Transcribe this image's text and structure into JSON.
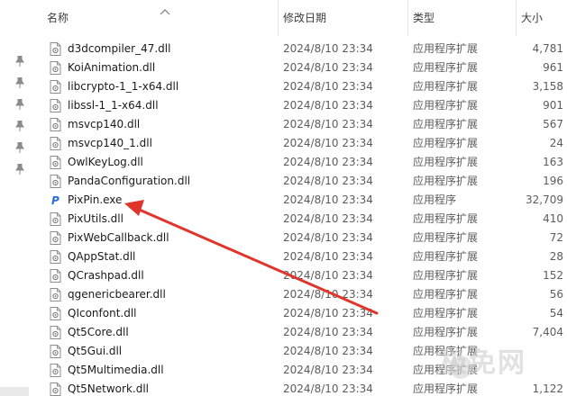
{
  "header": {
    "name": "名称",
    "date": "修改日期",
    "type": "类型",
    "size": "大小"
  },
  "files": [
    {
      "name": "d3dcompiler_47.dll",
      "date": "2024/8/10 23:34",
      "type": "应用程序扩展",
      "size": "4,781",
      "icon": "dll-file-icon"
    },
    {
      "name": "KoiAnimation.dll",
      "date": "2024/8/10 23:34",
      "type": "应用程序扩展",
      "size": "961",
      "icon": "dll-file-icon"
    },
    {
      "name": "libcrypto-1_1-x64.dll",
      "date": "2024/8/10 23:34",
      "type": "应用程序扩展",
      "size": "3,158",
      "icon": "dll-file-icon"
    },
    {
      "name": "libssl-1_1-x64.dll",
      "date": "2024/8/10 23:34",
      "type": "应用程序扩展",
      "size": "901",
      "icon": "dll-file-icon"
    },
    {
      "name": "msvcp140.dll",
      "date": "2024/8/10 23:34",
      "type": "应用程序扩展",
      "size": "567",
      "icon": "dll-file-icon"
    },
    {
      "name": "msvcp140_1.dll",
      "date": "2024/8/10 23:34",
      "type": "应用程序扩展",
      "size": "24",
      "icon": "dll-file-icon"
    },
    {
      "name": "OwlKeyLog.dll",
      "date": "2024/8/10 23:34",
      "type": "应用程序扩展",
      "size": "163",
      "icon": "dll-file-icon"
    },
    {
      "name": "PandaConfiguration.dll",
      "date": "2024/8/10 23:34",
      "type": "应用程序扩展",
      "size": "196",
      "icon": "dll-file-icon"
    },
    {
      "name": "PixPin.exe",
      "date": "2024/8/10 23:34",
      "type": "应用程序",
      "size": "32,709",
      "icon": "pixpin-app-icon"
    },
    {
      "name": "PixUtils.dll",
      "date": "2024/8/10 23:34",
      "type": "应用程序扩展",
      "size": "410",
      "icon": "dll-file-icon"
    },
    {
      "name": "PixWebCallback.dll",
      "date": "2024/8/10 23:34",
      "type": "应用程序扩展",
      "size": "72",
      "icon": "dll-file-icon"
    },
    {
      "name": "QAppStat.dll",
      "date": "2024/8/10 23:34",
      "type": "应用程序扩展",
      "size": "28",
      "icon": "dll-file-icon"
    },
    {
      "name": "QCrashpad.dll",
      "date": "2024/8/10 23:34",
      "type": "应用程序扩展",
      "size": "152",
      "icon": "dll-file-icon"
    },
    {
      "name": "qgenericbearer.dll",
      "date": "2024/8/10 23:34",
      "type": "应用程序扩展",
      "size": "56",
      "icon": "dll-file-icon"
    },
    {
      "name": "QIconfont.dll",
      "date": "2024/8/10 23:34",
      "type": "应用程序扩展",
      "size": "54",
      "icon": "dll-file-icon"
    },
    {
      "name": "Qt5Core.dll",
      "date": "2024/8/10 23:34",
      "type": "应用程序扩展",
      "size": "7,404",
      "icon": "dll-file-icon"
    },
    {
      "name": "Qt5Gui.dll",
      "date": "2024/8/10 23:34",
      "type": "应用程序扩展",
      "size": "",
      "icon": "dll-file-icon"
    },
    {
      "name": "Qt5Multimedia.dll",
      "date": "2024/8/10 23:34",
      "type": "应用程序扩展",
      "size": "",
      "icon": "dll-file-icon"
    },
    {
      "name": "Qt5Network.dll",
      "date": "2024/8/10 23:34",
      "type": "应用程序扩展",
      "size": "1,122",
      "icon": "dll-file-icon"
    }
  ],
  "annotation": {
    "arrow_color": "#e0352b",
    "points_to": "PixPin.exe"
  },
  "quick_access_pins": [
    "pin-icon",
    "pin-icon",
    "pin-icon",
    "pin-icon",
    "pin-icon",
    "pin-icon"
  ],
  "watermark": "极免网"
}
